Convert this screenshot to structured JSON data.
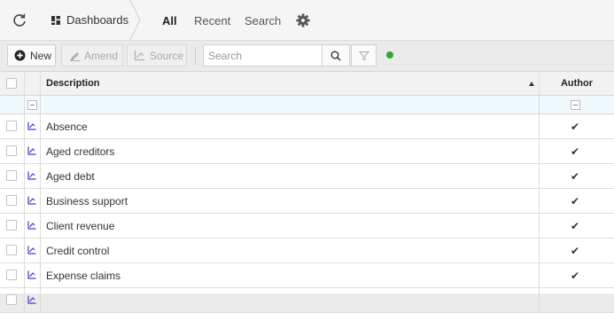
{
  "nav": {
    "breadcrumb": "Dashboards",
    "tabs": [
      {
        "label": "All",
        "active": true
      },
      {
        "label": "Recent",
        "active": false
      },
      {
        "label": "Search",
        "active": false
      }
    ]
  },
  "toolbar": {
    "new_label": "New",
    "amend_label": "Amend",
    "source_label": "Source",
    "search_placeholder": "Search",
    "search_value": "",
    "status_color": "#3aa33a"
  },
  "grid": {
    "columns": {
      "description": "Description",
      "author": "Author"
    },
    "sort": {
      "column": "description",
      "direction": "ascending"
    },
    "rows": [
      {
        "description": "Absence",
        "author": "✔"
      },
      {
        "description": "Aged creditors",
        "author": "✔"
      },
      {
        "description": "Aged debt",
        "author": "✔"
      },
      {
        "description": "Business support",
        "author": "✔"
      },
      {
        "description": "Client revenue",
        "author": "✔"
      },
      {
        "description": "Credit control",
        "author": "✔"
      },
      {
        "description": "Expense claims",
        "author": "✔"
      },
      {
        "description": "",
        "author": ""
      }
    ]
  },
  "colors": {
    "accent": "#3d3dcf",
    "status": "#3aa33a"
  }
}
